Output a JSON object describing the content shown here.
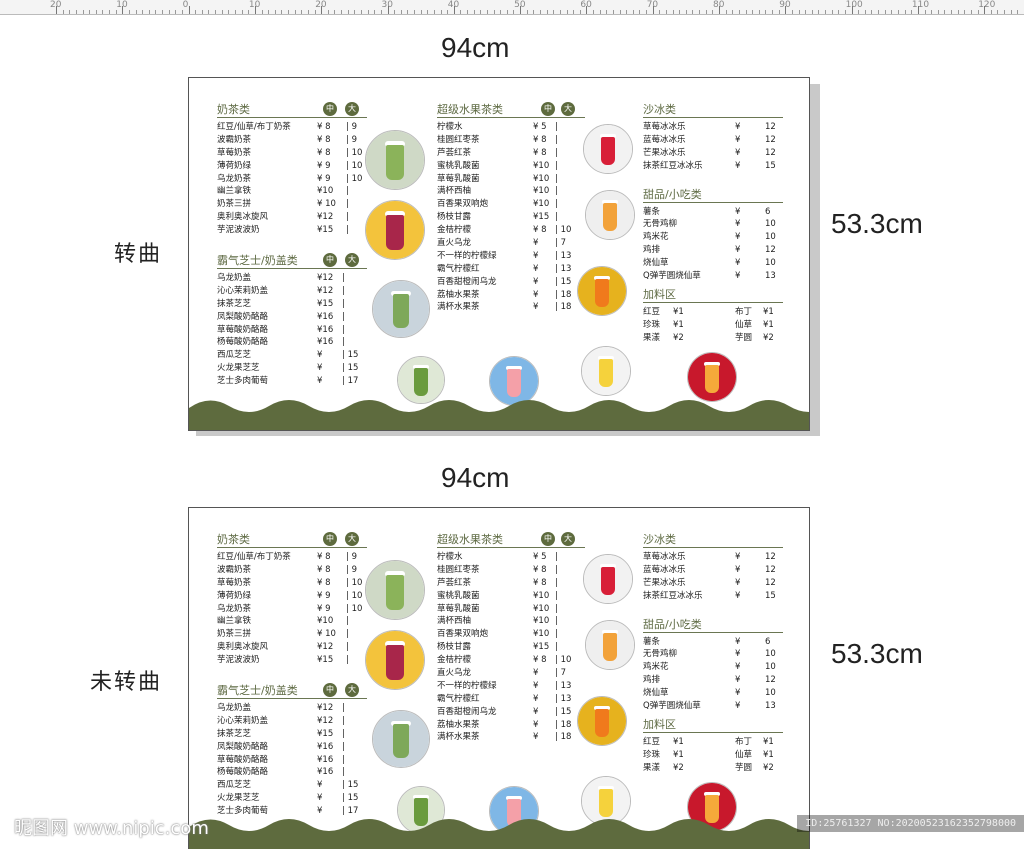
{
  "ruler": {
    "labels": [
      "20",
      "10",
      "0",
      "10",
      "20",
      "30",
      "40",
      "50",
      "60",
      "70",
      "80",
      "90",
      "100",
      "110",
      "120"
    ]
  },
  "top": {
    "width_label": "94cm",
    "height_label": "53.3cm",
    "side_label": "转曲"
  },
  "bottom": {
    "width_label": "94cm",
    "height_label": "53.3cm",
    "side_label": "未转曲"
  },
  "menu": {
    "milk_tea": {
      "title": "奶茶类",
      "size_mid": "中",
      "size_large": "大",
      "items": [
        {
          "name": "红豆/仙草/布丁奶茶",
          "mid": "¥ 8",
          "large": "| 9"
        },
        {
          "name": "波霸奶茶",
          "mid": "¥ 8",
          "large": "| 9"
        },
        {
          "name": "草莓奶茶",
          "mid": "¥ 8",
          "large": "| 10"
        },
        {
          "name": "薄荷奶绿",
          "mid": "¥ 9",
          "large": "| 10"
        },
        {
          "name": "乌龙奶茶",
          "mid": "¥ 9",
          "large": "| 10"
        },
        {
          "name": "幽兰拿铁",
          "mid": "¥10",
          "large": "|"
        },
        {
          "name": "奶茶三拼",
          "mid": "¥ 10",
          "large": "|"
        },
        {
          "name": "奥利奥冰旋风",
          "mid": "¥12",
          "large": "|"
        },
        {
          "name": "芋泥波波奶",
          "mid": "¥15",
          "large": "|"
        }
      ]
    },
    "cheese": {
      "title": "霸气芝士/奶盖类",
      "size_mid": "中",
      "size_large": "大",
      "items": [
        {
          "name": "乌龙奶盖",
          "mid": "¥12",
          "large": "|"
        },
        {
          "name": "沁心茉莉奶盖",
          "mid": "¥12",
          "large": "|"
        },
        {
          "name": "抹茶芝芝",
          "mid": "¥15",
          "large": "|"
        },
        {
          "name": "凤梨酸奶酪酪",
          "mid": "¥16",
          "large": "|"
        },
        {
          "name": "草莓酸奶酪酪",
          "mid": "¥16",
          "large": "|"
        },
        {
          "name": "杨莓酸奶酪酪",
          "mid": "¥16",
          "large": "|"
        },
        {
          "name": "西瓜芝芝",
          "mid": "¥",
          "large": "| 15"
        },
        {
          "name": "火龙果芝芝",
          "mid": "¥",
          "large": "| 15"
        },
        {
          "name": "芝士多肉葡萄",
          "mid": "¥",
          "large": "| 17"
        }
      ]
    },
    "fruit_tea": {
      "title": "超级水果茶类",
      "size_mid": "中",
      "size_large": "大",
      "items": [
        {
          "name": "柠檬水",
          "mid": "¥ 5",
          "large": "|"
        },
        {
          "name": "桂圆红枣茶",
          "mid": "¥ 8",
          "large": "|"
        },
        {
          "name": "芦荟红茶",
          "mid": "¥ 8",
          "large": "|"
        },
        {
          "name": "蜜桃乳酸菌",
          "mid": "¥10",
          "large": "|"
        },
        {
          "name": "草莓乳酸菌",
          "mid": "¥10",
          "large": "|"
        },
        {
          "name": "满杯西柚",
          "mid": "¥10",
          "large": "|"
        },
        {
          "name": "百香果双响炮",
          "mid": "¥10",
          "large": "|"
        },
        {
          "name": "杨枝甘露",
          "mid": "¥15",
          "large": "|"
        },
        {
          "name": "金桔柠檬",
          "mid": "¥ 8",
          "large": "| 10"
        },
        {
          "name": "直火乌龙",
          "mid": "¥",
          "large": "| 7"
        },
        {
          "name": "不一样的柠檬绿",
          "mid": "¥",
          "large": "| 13"
        },
        {
          "name": "霸气柠檬红",
          "mid": "¥",
          "large": "| 13"
        },
        {
          "name": "百香甜橙闹乌龙",
          "mid": "¥",
          "large": "| 15"
        },
        {
          "name": "荔柚水果茶",
          "mid": "¥",
          "large": "| 18"
        },
        {
          "name": "满杯水果茶",
          "mid": "¥",
          "large": "| 18"
        }
      ]
    },
    "smoothie": {
      "title": "沙冰类",
      "items": [
        {
          "name": "草莓冰冰乐",
          "cur": "¥",
          "price": "12"
        },
        {
          "name": "蓝莓冰冰乐",
          "cur": "¥",
          "price": "12"
        },
        {
          "name": "芒果冰冰乐",
          "cur": "¥",
          "price": "12"
        },
        {
          "name": "抹茶红豆冰冰乐",
          "cur": "¥",
          "price": "15"
        }
      ]
    },
    "snacks": {
      "title": "甜品/小吃类",
      "items": [
        {
          "name": "薯条",
          "cur": "¥",
          "price": "6"
        },
        {
          "name": "无骨鸡柳",
          "cur": "¥",
          "price": "10"
        },
        {
          "name": "鸡米花",
          "cur": "¥",
          "price": "10"
        },
        {
          "name": "鸡排",
          "cur": "¥",
          "price": "12"
        },
        {
          "name": "烧仙草",
          "cur": "¥",
          "price": "10"
        },
        {
          "name": "Q弹芋圆烧仙草",
          "cur": "¥",
          "price": "13"
        }
      ]
    },
    "toppings": {
      "title": "加料区",
      "rows": [
        {
          "a": "红豆",
          "ap": "¥1",
          "b": "布丁",
          "bp": "¥1"
        },
        {
          "a": "珍珠",
          "ap": "¥1",
          "b": "仙草",
          "bp": "¥1"
        },
        {
          "a": "果漾",
          "ap": "¥2",
          "b": "芋圆",
          "bp": "¥2"
        }
      ]
    }
  },
  "colors": {
    "olive": "#5e6b3e",
    "section_text": "#5e6a43",
    "board_border": "#555555"
  },
  "footer": {
    "watermark": "昵图网 www.nipic.com",
    "id_text": "ID:25761327 NO:20200523162352798000"
  }
}
